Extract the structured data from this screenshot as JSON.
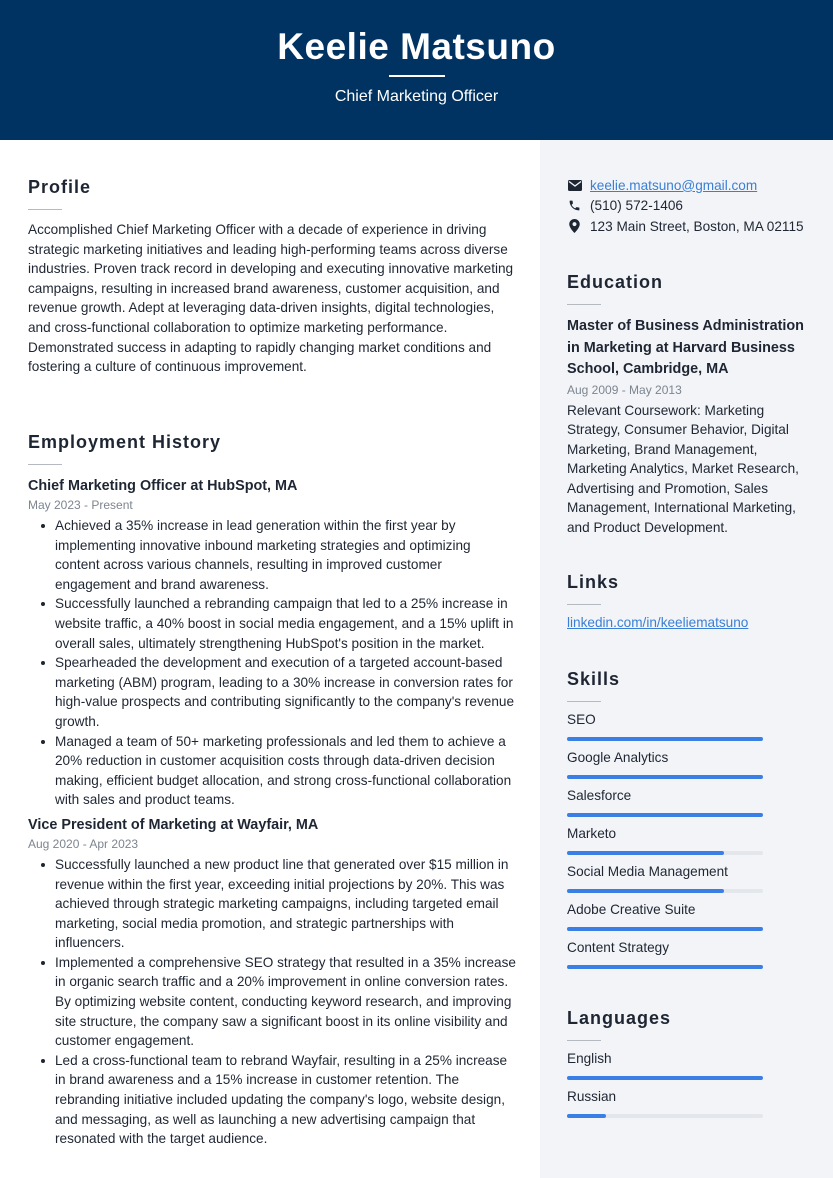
{
  "header": {
    "name": "Keelie Matsuno",
    "title": "Chief Marketing Officer"
  },
  "colors": {
    "header_bg": "#003361",
    "sidebar_bg": "#f2f4f7",
    "accent": "#3a7fe6",
    "link": "#3a7fd5"
  },
  "profile": {
    "heading": "Profile",
    "text": "Accomplished Chief Marketing Officer with a decade of experience in driving strategic marketing initiatives and leading high-performing teams across diverse industries. Proven track record in developing and executing innovative marketing campaigns, resulting in increased brand awareness, customer acquisition, and revenue growth. Adept at leveraging data-driven insights, digital technologies, and cross-functional collaboration to optimize marketing performance. Demonstrated success in adapting to rapidly changing market conditions and fostering a culture of continuous improvement."
  },
  "employment": {
    "heading": "Employment History",
    "jobs": [
      {
        "title": "Chief Marketing Officer at HubSpot, MA",
        "dates": "May 2023 - Present",
        "bullets": [
          "Achieved a 35% increase in lead generation within the first year by implementing innovative inbound marketing strategies and optimizing content across various channels, resulting in improved customer engagement and brand awareness.",
          "Successfully launched a rebranding campaign that led to a 25% increase in website traffic, a 40% boost in social media engagement, and a 15% uplift in overall sales, ultimately strengthening HubSpot's position in the market.",
          "Spearheaded the development and execution of a targeted account-based marketing (ABM) program, leading to a 30% increase in conversion rates for high-value prospects and contributing significantly to the company's revenue growth.",
          "Managed a team of 50+ marketing professionals and led them to achieve a 20% reduction in customer acquisition costs through data-driven decision making, efficient budget allocation, and strong cross-functional collaboration with sales and product teams."
        ]
      },
      {
        "title": "Vice President of Marketing at Wayfair, MA",
        "dates": "Aug 2020 - Apr 2023",
        "bullets": [
          "Successfully launched a new product line that generated over $15 million in revenue within the first year, exceeding initial projections by 20%. This was achieved through strategic marketing campaigns, including targeted email marketing, social media promotion, and strategic partnerships with influencers.",
          "Implemented a comprehensive SEO strategy that resulted in a 35% increase in organic search traffic and a 20% improvement in online conversion rates. By optimizing website content, conducting keyword research, and improving site structure, the company saw a significant boost in its online visibility and customer engagement.",
          "Led a cross-functional team to rebrand Wayfair, resulting in a 25% increase in brand awareness and a 15% increase in customer retention. The rebranding initiative included updating the company's logo, website design, and messaging, as well as launching a new advertising campaign that resonated with the target audience."
        ]
      }
    ]
  },
  "contact": {
    "email": "keelie.matsuno@gmail.com",
    "phone": "(510) 572-1406",
    "address": "123 Main Street, Boston, MA 02115",
    "icons": [
      "envelope-icon",
      "phone-icon",
      "map-pin-icon"
    ]
  },
  "education": {
    "heading": "Education",
    "degree": "Master of Business Administration in Marketing at Harvard Business School, Cambridge, MA",
    "dates": "Aug 2009 - May 2013",
    "coursework": "Relevant Coursework: Marketing Strategy, Consumer Behavior, Digital Marketing, Brand Management, Marketing Analytics, Market Research, Advertising and Promotion, Sales Management, International Marketing, and Product Development."
  },
  "links": {
    "heading": "Links",
    "items": [
      "linkedin.com/in/keeliematsuno"
    ]
  },
  "skills": {
    "heading": "Skills",
    "items": [
      {
        "name": "SEO",
        "level": 1.0
      },
      {
        "name": "Google Analytics",
        "level": 1.0
      },
      {
        "name": "Salesforce",
        "level": 1.0
      },
      {
        "name": "Marketo",
        "level": 0.8
      },
      {
        "name": "Social Media Management",
        "level": 0.8
      },
      {
        "name": "Adobe Creative Suite",
        "level": 1.0
      },
      {
        "name": "Content Strategy",
        "level": 1.0
      }
    ]
  },
  "languages": {
    "heading": "Languages",
    "items": [
      {
        "name": "English",
        "level": 1.0
      },
      {
        "name": "Russian",
        "level": 0.2
      }
    ]
  }
}
